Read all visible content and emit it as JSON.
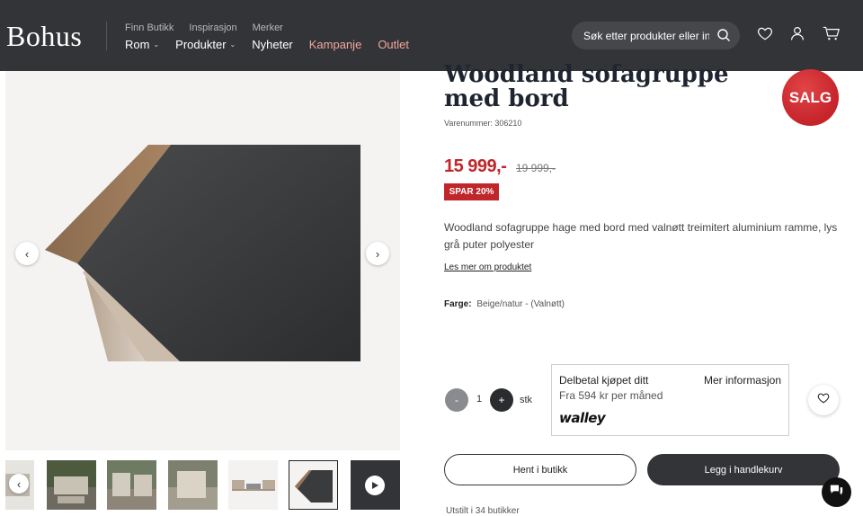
{
  "header": {
    "logo": "Bohus",
    "top_links": [
      "Finn Butikk",
      "Inspirasjon",
      "Merker"
    ],
    "main_nav": [
      {
        "label": "Rom",
        "has_dropdown": true
      },
      {
        "label": "Produkter",
        "has_dropdown": true
      },
      {
        "label": "Nyheter",
        "has_dropdown": false
      },
      {
        "label": "Kampanje",
        "has_dropdown": false
      },
      {
        "label": "Outlet",
        "has_dropdown": false
      }
    ],
    "search_placeholder": "Søk etter produkter eller innhold",
    "icons": [
      "heart-icon",
      "user-icon",
      "cart-icon"
    ],
    "colors": {
      "background": "#333438",
      "accent": "#f0a89a"
    }
  },
  "gallery": {
    "prev_icon": "chevron-left-icon",
    "next_icon": "chevron-right-icon",
    "thumbnail_count": 7,
    "active_thumbnail": 6,
    "video_icon": "play-icon"
  },
  "product": {
    "title": "Woodland sofagruppe med bord",
    "sku_label": "Varenummer: 306210",
    "sale_badge": "SALG",
    "price": "15 999,-",
    "old_price": "19 999,-",
    "discount_label": "SPAR 20%",
    "description": "Woodland sofagruppe hage med bord med valnøtt treimitert aluminium ramme, lys grå puter polyester",
    "read_more": "Les mer om produktet",
    "color_label": "Farge:",
    "color_value": "Beige/natur - (Valnøtt)",
    "sale_color": "#c0262a"
  },
  "quantity": {
    "minus": "-",
    "value": "1",
    "plus": "+",
    "unit": "stk"
  },
  "payment": {
    "title": "Delbetal kjøpet ditt",
    "more_info": "Mer informasjon",
    "per_month": "Fra 594 kr per måned",
    "provider": "walley"
  },
  "actions": {
    "pickup_button": "Hent i butikk",
    "cart_button": "Legg i handlekurv",
    "stock_text": "Utstilt i 34 butikker"
  }
}
